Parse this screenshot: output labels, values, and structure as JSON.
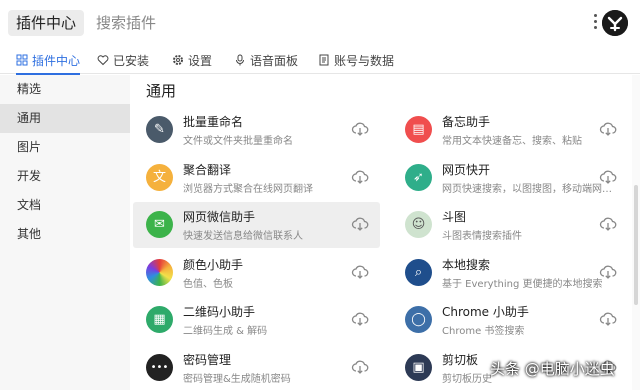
{
  "header": {
    "app_title": "插件中心",
    "search_placeholder": "搜索插件"
  },
  "tabs": [
    {
      "label": "插件中心",
      "icon": "grid-icon",
      "active": true
    },
    {
      "label": "已安装",
      "icon": "heart-icon"
    },
    {
      "label": "设置",
      "icon": "gear-icon"
    },
    {
      "label": "语音面板",
      "icon": "microphone-icon"
    },
    {
      "label": "账号与数据",
      "icon": "document-icon"
    }
  ],
  "sidebar": {
    "items": [
      {
        "label": "精选"
      },
      {
        "label": "通用",
        "active": true
      },
      {
        "label": "图片"
      },
      {
        "label": "开发"
      },
      {
        "label": "文档"
      },
      {
        "label": "其他"
      }
    ]
  },
  "main": {
    "section_title": "通用",
    "plugins": [
      {
        "name": "批量重命名",
        "desc": "文件或文件夹批量重命名",
        "icon": "rename-pen-icon",
        "color": "#4a5a6a"
      },
      {
        "name": "备忘助手",
        "desc": "常用文本快速备忘、搜索、粘贴",
        "icon": "notebook-icon",
        "color": "#f04e4e"
      },
      {
        "name": "聚合翻译",
        "desc": "浏览器方式聚合在线网页翻译",
        "icon": "translate-icon",
        "color": "#f5b13d"
      },
      {
        "name": "网页快开",
        "desc": "网页快速搜索，以图搜图，移动端网…",
        "icon": "rocket-icon",
        "color": "#2fae8a"
      },
      {
        "name": "网页微信助手",
        "desc": "快速发送信息给微信联系人",
        "icon": "wechat-icon",
        "color": "#3cb34a",
        "hover": true
      },
      {
        "name": "斗图",
        "desc": "斗图表情搜索插件",
        "icon": "meme-face-icon",
        "color": "#cfe3cf"
      },
      {
        "name": "颜色小助手",
        "desc": "色值、色板",
        "icon": "color-wheel-icon",
        "color": "#e53b3b"
      },
      {
        "name": "本地搜索",
        "desc": "基于 Everything 更便捷的本地搜索",
        "icon": "magnifier-icon",
        "color": "#1f4e8c"
      },
      {
        "name": "二维码小助手",
        "desc": "二维码生成 & 解码",
        "icon": "qrcode-icon",
        "color": "#2eaa6a"
      },
      {
        "name": "Chrome 小助手",
        "desc": "Chrome 书签搜索",
        "icon": "chrome-icon",
        "color": "#3d6fa8"
      },
      {
        "name": "密码管理",
        "desc": "密码管理&生成随机密码",
        "icon": "password-dots-icon",
        "color": "#222222"
      },
      {
        "name": "剪切板",
        "desc": "剪切板历史",
        "icon": "clipboard-icon",
        "color": "#2d3a55"
      }
    ]
  },
  "watermark": "头条 @电脑小迷虫",
  "accent_color": "#2e6fe0"
}
